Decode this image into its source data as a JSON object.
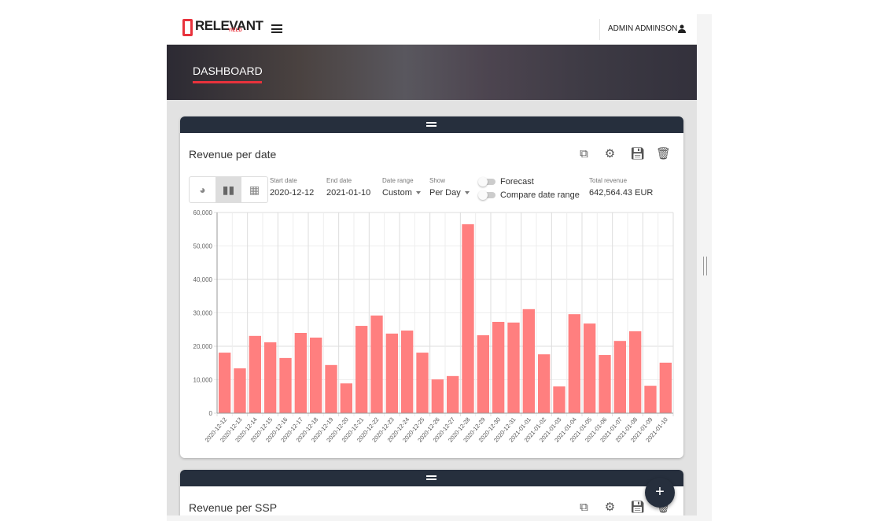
{
  "header": {
    "brand": "RELEVANT",
    "brand_sub": "YIELD",
    "user": "ADMIN ADMINSON"
  },
  "banner": {
    "title": "DASHBOARD"
  },
  "widgets": [
    {
      "title": "Revenue per date",
      "filters": {
        "start_date_label": "Start date",
        "start_date": "2020-12-12",
        "end_date_label": "End date",
        "end_date": "2021-01-10",
        "date_range_label": "Date range",
        "date_range": "Custom",
        "show_label": "Show",
        "show": "Per Day",
        "forecast": "Forecast",
        "forecast_on": false,
        "compare": "Compare date range",
        "compare_on": false,
        "total_label": "Total revenue",
        "total": "642,564.43 EUR"
      },
      "active_view": "bar"
    },
    {
      "title": "Revenue per SSP"
    }
  ],
  "colors": {
    "bar": "#ff7f7f",
    "nav": "#262f3d",
    "accent": "#e8323c"
  },
  "chart_data": {
    "type": "bar",
    "categories": [
      "2020-12-12",
      "2020-12-13",
      "2020-12-14",
      "2020-12-15",
      "2020-12-16",
      "2020-12-17",
      "2020-12-18",
      "2020-12-19",
      "2020-12-20",
      "2020-12-21",
      "2020-12-22",
      "2020-12-23",
      "2020-12-24",
      "2020-12-25",
      "2020-12-26",
      "2020-12-27",
      "2020-12-28",
      "2020-12-29",
      "2020-12-30",
      "2020-12-31",
      "2021-01-01",
      "2021-01-02",
      "2021-01-03",
      "2021-01-04",
      "2021-01-05",
      "2021-01-06",
      "2021-01-07",
      "2021-01-08",
      "2021-01-09",
      "2021-01-10"
    ],
    "values": [
      18100,
      13400,
      23100,
      21200,
      16500,
      24000,
      22600,
      14400,
      8900,
      26100,
      29200,
      23800,
      24700,
      18100,
      10100,
      11100,
      56500,
      23300,
      27300,
      27100,
      31100,
      17600,
      8000,
      29600,
      26800,
      17400,
      21600,
      24500,
      8200,
      15100
    ],
    "ylim": [
      0,
      60000
    ],
    "yticks": [
      "0",
      "10,000",
      "20,000",
      "30,000",
      "40,000",
      "50,000",
      "60,000"
    ],
    "grid": true
  }
}
